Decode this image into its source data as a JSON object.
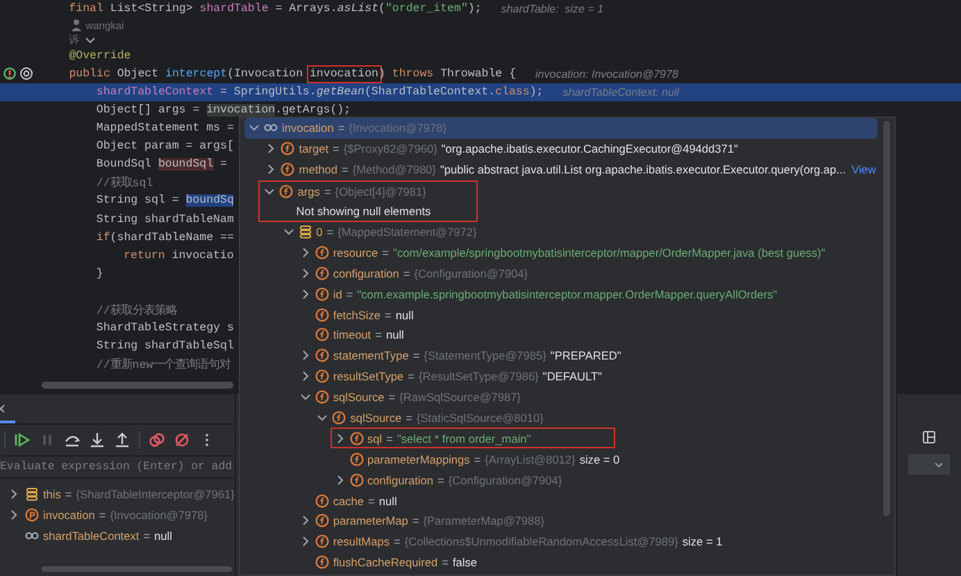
{
  "editor": {
    "lines": [
      {
        "kind": "code",
        "segments": [
          {
            "kind": "keyword",
            "text": "final "
          },
          {
            "kind": "plain",
            "text": "List<String> "
          },
          {
            "kind": "field",
            "text": "shardTable"
          },
          {
            "kind": "plain",
            "text": " = Arrays."
          },
          {
            "kind": "italic",
            "text": "asList"
          },
          {
            "kind": "plain",
            "text": "("
          },
          {
            "kind": "string",
            "text": "\"order_item\""
          },
          {
            "kind": "plain",
            "text": ");"
          }
        ],
        "hint": "shardTable:  size = 1"
      },
      {
        "kind": "author",
        "text": "wangkai"
      },
      {
        "kind": "usages",
        "text": "诉"
      },
      {
        "kind": "code",
        "segments": [
          {
            "kind": "annotation",
            "text": "@Override"
          }
        ]
      },
      {
        "kind": "code",
        "gutter": [
          {
            "kind": "implements"
          },
          {
            "kind": "at"
          }
        ],
        "segments": [
          {
            "kind": "keyword",
            "text": "public "
          },
          {
            "kind": "plain",
            "text": "Object "
          },
          {
            "kind": "method",
            "text": "intercept"
          },
          {
            "kind": "plain",
            "text": "(Invocation "
          },
          {
            "kind": "plain",
            "text": "invocation",
            "boxed": true
          },
          {
            "kind": "plain",
            "text": ") "
          },
          {
            "kind": "keyword",
            "text": "throws "
          },
          {
            "kind": "plain",
            "text": "Throwable {"
          }
        ],
        "hint": "invocation: Invocation@7978",
        "children": [
          {
            "kind": "code",
            "current": true,
            "segments": [
              {
                "kind": "field",
                "text": "shardTableContext"
              },
              {
                "kind": "plain",
                "text": " = SpringUtils."
              },
              {
                "kind": "italic",
                "text": "getBean"
              },
              {
                "kind": "plain",
                "text": "(ShardTableContext."
              },
              {
                "kind": "keyword",
                "text": "class"
              },
              {
                "kind": "plain",
                "text": ");"
              }
            ],
            "hint": "shardTableContext: null"
          },
          {
            "kind": "code",
            "segments": [
              {
                "kind": "plain",
                "text": "Object[] args = "
              },
              {
                "kind": "usage",
                "text": "invocation"
              },
              {
                "kind": "plain",
                "text": ".getArgs();"
              }
            ]
          },
          {
            "kind": "code",
            "segments": [
              {
                "kind": "plain",
                "text": "MappedStatement ms ="
              }
            ]
          },
          {
            "kind": "code",
            "segments": [
              {
                "kind": "plain",
                "text": "Object param = args["
              }
            ]
          },
          {
            "kind": "code",
            "segments": [
              {
                "kind": "plain",
                "text": "BoundSql "
              },
              {
                "kind": "variable",
                "text": "boundSql"
              },
              {
                "kind": "plain",
                "text": " ="
              }
            ]
          },
          {
            "kind": "code",
            "segments": [
              {
                "kind": "comment",
                "text": "//获取sql"
              }
            ]
          },
          {
            "kind": "code",
            "segments": [
              {
                "kind": "plain",
                "text": "String sql = "
              },
              {
                "kind": "selection",
                "text": "boundSq"
              }
            ]
          },
          {
            "kind": "code",
            "segments": [
              {
                "kind": "plain",
                "text": "String shardTableNam"
              }
            ]
          },
          {
            "kind": "code",
            "segments": [
              {
                "kind": "keyword",
                "text": "if"
              },
              {
                "kind": "plain",
                "text": "(shardTableName =="
              }
            ],
            "children": [
              {
                "kind": "code",
                "segments": [
                  {
                    "kind": "keyword",
                    "text": "return "
                  },
                  {
                    "kind": "plain",
                    "text": "invocatio"
                  }
                ]
              }
            ]
          },
          {
            "kind": "code",
            "segments": [
              {
                "kind": "plain",
                "text": "}"
              }
            ]
          },
          {
            "kind": "blank"
          },
          {
            "kind": "code",
            "segments": [
              {
                "kind": "comment",
                "text": "//获取分表策略"
              }
            ]
          },
          {
            "kind": "code",
            "segments": [
              {
                "kind": "plain",
                "text": "ShardTableStrategy s"
              }
            ]
          },
          {
            "kind": "code",
            "segments": [
              {
                "kind": "plain",
                "text": "String shardTableSql"
              }
            ]
          },
          {
            "kind": "code",
            "segments": [
              {
                "kind": "comment",
                "text": "//重新new一个查询语句对"
              }
            ]
          }
        ]
      }
    ]
  },
  "popup": {
    "tree": [
      {
        "kind": "watch",
        "name": "invocation",
        "sep": "=",
        "type": "{Invocation@7978}",
        "expanded": true,
        "selected": true,
        "children": [
          {
            "kind": "field",
            "name": "target",
            "sep": "=",
            "type": "{$Proxy82@7960}",
            "value": {
              "kind": "plain",
              "text": "\"org.apache.ibatis.executor.CachingExecutor@494dd371\""
            },
            "expanded": false,
            "selected": false
          },
          {
            "kind": "field",
            "name": "method",
            "sep": "=",
            "type": "{Method@7980}",
            "value": {
              "kind": "plain",
              "text": "\"public abstract java.util.List org.apache.ibatis.executor.Executor.query(org.ap..."
            },
            "link": "View",
            "expanded": false,
            "selected": false
          },
          {
            "kind": "field",
            "name": "args",
            "sep": "=",
            "type": "{Object[4]@7981}",
            "note": "Not showing null elements",
            "boxed": true,
            "expanded": true,
            "selected": false,
            "children": [
              {
                "kind": "array",
                "name": "0",
                "sep": "=",
                "type": "{MappedStatement@7972}",
                "expanded": true,
                "selected": false,
                "children": [
                  {
                    "kind": "field",
                    "name": "resource",
                    "sep": "=",
                    "value": {
                      "kind": "string",
                      "text": "\"com/example/springbootmybatisinterceptor/mapper/OrderMapper.java (best guess)\""
                    },
                    "expanded": false,
                    "selected": false
                  },
                  {
                    "kind": "field",
                    "name": "configuration",
                    "sep": "=",
                    "type": "{Configuration@7904}",
                    "expanded": false,
                    "selected": false
                  },
                  {
                    "kind": "field",
                    "name": "id",
                    "sep": "=",
                    "value": {
                      "kind": "string",
                      "text": "\"com.example.springbootmybatisinterceptor.mapper.OrderMapper.queryAllOrders\""
                    },
                    "expanded": false,
                    "selected": false
                  },
                  {
                    "kind": "field",
                    "name": "fetchSize",
                    "sep": "=",
                    "value": {
                      "kind": "plain",
                      "text": "null"
                    },
                    "selected": false
                  },
                  {
                    "kind": "field",
                    "name": "timeout",
                    "sep": "=",
                    "value": {
                      "kind": "plain",
                      "text": "null"
                    },
                    "selected": false
                  },
                  {
                    "kind": "field",
                    "name": "statementType",
                    "sep": "=",
                    "type": "{StatementType@7985}",
                    "value": {
                      "kind": "plain",
                      "text": "\"PREPARED\""
                    },
                    "expanded": false,
                    "selected": false
                  },
                  {
                    "kind": "field",
                    "name": "resultSetType",
                    "sep": "=",
                    "type": "{ResultSetType@7986}",
                    "value": {
                      "kind": "plain",
                      "text": "\"DEFAULT\""
                    },
                    "expanded": false,
                    "selected": false
                  },
                  {
                    "kind": "field",
                    "name": "sqlSource",
                    "sep": "=",
                    "type": "{RawSqlSource@7987}",
                    "expanded": true,
                    "selected": false,
                    "children": [
                      {
                        "kind": "field",
                        "name": "sqlSource",
                        "sep": "=",
                        "type": "{StaticSqlSource@8010}",
                        "expanded": true,
                        "selected": false,
                        "children": [
                          {
                            "kind": "field",
                            "name": "sql",
                            "sep": "=",
                            "value": {
                              "kind": "string",
                              "text": "\"select * from order_main\""
                            },
                            "boxed": true,
                            "expanded": false,
                            "selected": false
                          },
                          {
                            "kind": "field",
                            "name": "parameterMappings",
                            "sep": "=",
                            "type": "{ArrayList@8012}",
                            "value": {
                              "kind": "plain",
                              "text": "size = 0"
                            },
                            "selected": false
                          },
                          {
                            "kind": "field",
                            "name": "configuration",
                            "sep": "=",
                            "type": "{Configuration@7904}",
                            "expanded": false,
                            "selected": false
                          }
                        ]
                      }
                    ]
                  },
                  {
                    "kind": "field",
                    "name": "cache",
                    "sep": "=",
                    "value": {
                      "kind": "plain",
                      "text": "null"
                    },
                    "selected": false
                  },
                  {
                    "kind": "field",
                    "name": "parameterMap",
                    "sep": "=",
                    "type": "{ParameterMap@7988}",
                    "expanded": false,
                    "selected": false
                  },
                  {
                    "kind": "field",
                    "name": "resultMaps",
                    "sep": "=",
                    "type": "{Collections$UnmodifiableRandomAccessList@7989}",
                    "value": {
                      "kind": "plain",
                      "text": "size = 1"
                    },
                    "expanded": false,
                    "selected": false
                  },
                  {
                    "kind": "field",
                    "name": "flushCacheRequired",
                    "sep": "=",
                    "value": {
                      "kind": "plain",
                      "text": "false"
                    },
                    "selected": false
                  }
                ]
              }
            ]
          }
        ]
      }
    ]
  },
  "debugger": {
    "toolbar": [
      {
        "kind": "resume",
        "disabled": false
      },
      {
        "kind": "pause",
        "disabled": true
      },
      {
        "kind": "step-over",
        "disabled": false
      },
      {
        "kind": "step-into",
        "disabled": false
      },
      {
        "kind": "step-out",
        "disabled": false
      },
      {
        "kind": "breakpoints",
        "disabled": false
      },
      {
        "kind": "mute",
        "disabled": false
      },
      {
        "kind": "more",
        "disabled": false
      }
    ],
    "evaluate": {
      "placeholder": "Evaluate expression (Enter) or add"
    },
    "variables": [
      {
        "kind": "array",
        "name": "this",
        "sep": "=",
        "type": "{ShardTableInterceptor@7961}",
        "expanded": false
      },
      {
        "kind": "param",
        "name": "invocation",
        "sep": "=",
        "type": "{Invocation@7978}",
        "expanded": false
      },
      {
        "kind": "watch",
        "name": "shardTableContext",
        "sep": "=",
        "value": "null"
      }
    ]
  }
}
